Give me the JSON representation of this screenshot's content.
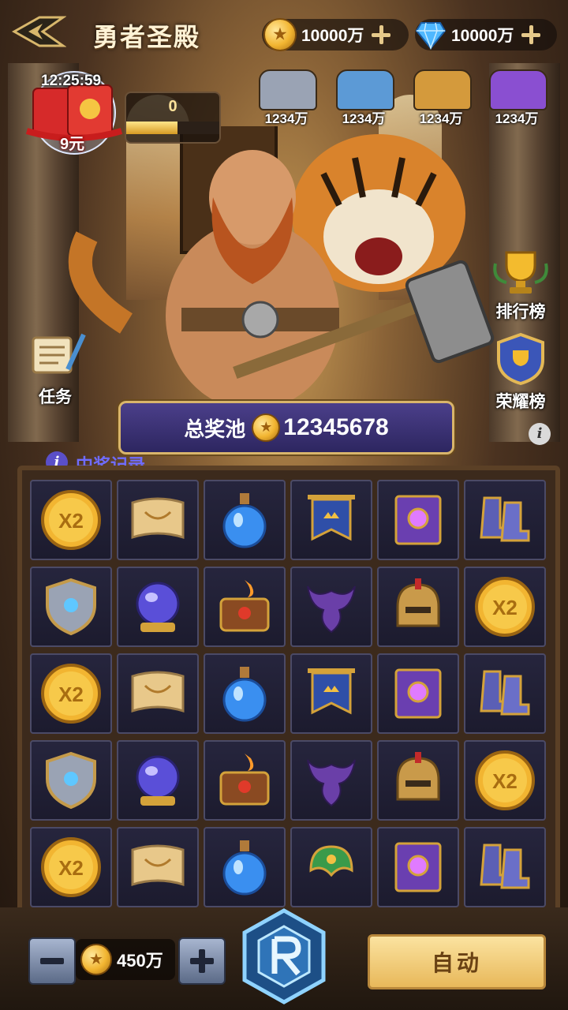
{
  "header": {
    "title": "勇者圣殿",
    "gold": "10000万",
    "diamond": "10000万"
  },
  "packet": {
    "timer": "12:25:59",
    "price": "9元",
    "progress_value": "0",
    "progress_fraction": 0.55
  },
  "chests": [
    {
      "label": "1234万",
      "color": "#9aa3b4"
    },
    {
      "label": "1234万",
      "color": "#5c9ad6"
    },
    {
      "label": "1234万",
      "color": "#d49a3c"
    },
    {
      "label": "1234万",
      "color": "#8a4fd1"
    }
  ],
  "side": {
    "task": "任务",
    "rank": "排行榜",
    "honor": "荣耀榜"
  },
  "pool": {
    "label": "总奖池",
    "value": "12345678"
  },
  "records_label": "中奖记录",
  "grid": [
    [
      "x2-coin-icon",
      "treasure-map-icon",
      "blue-potion-icon",
      "banner-icon",
      "spell-book-icon",
      "boots-icon"
    ],
    [
      "shield-icon",
      "crystal-orb-icon",
      "fire-chest-icon",
      "dragon-icon",
      "helmet-icon",
      "x2-coin-icon"
    ],
    [
      "x2-coin-icon",
      "treasure-map-icon",
      "blue-potion-icon",
      "banner-icon",
      "spell-book-icon",
      "boots-icon"
    ],
    [
      "shield-icon",
      "crystal-orb-icon",
      "fire-chest-icon",
      "dragon-icon",
      "helmet-icon",
      "x2-coin-icon"
    ],
    [
      "x2-coin-icon",
      "treasure-map-icon",
      "blue-potion-icon",
      "green-helmet-icon",
      "spell-book-icon",
      "boots-icon"
    ]
  ],
  "coin_x2_label": "X2",
  "bottom": {
    "bet": "450万",
    "auto": "自动"
  }
}
